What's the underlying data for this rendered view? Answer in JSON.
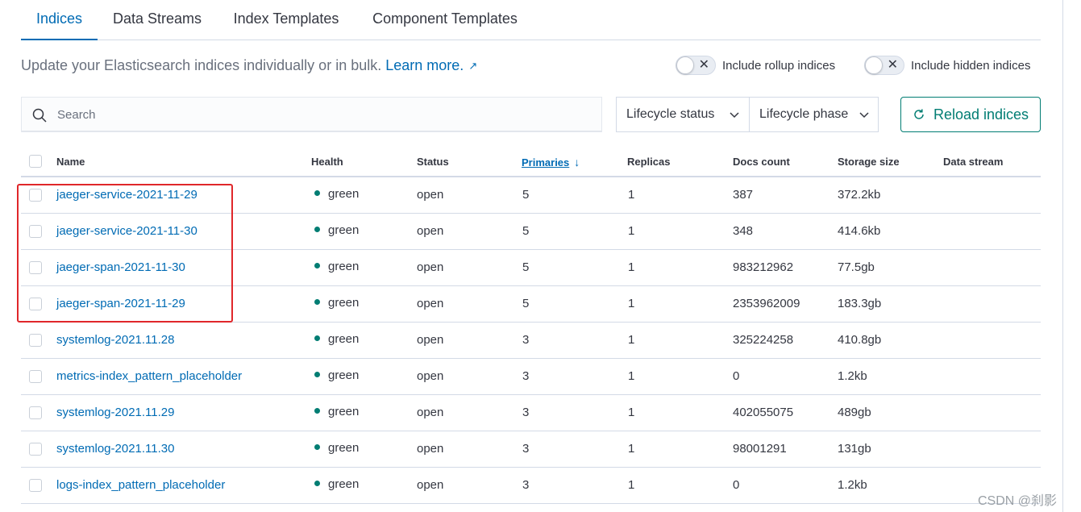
{
  "tabs": [
    {
      "label": "Indices",
      "active": true
    },
    {
      "label": "Data Streams",
      "active": false
    },
    {
      "label": "Index Templates",
      "active": false
    },
    {
      "label": "Component Templates",
      "active": false
    }
  ],
  "description": {
    "text": "Update your Elasticsearch indices individually or in bulk.",
    "link": "Learn more."
  },
  "toggles": {
    "rollup": "Include rollup indices",
    "hidden": "Include hidden indices"
  },
  "search": {
    "placeholder": "Search"
  },
  "filters": {
    "lifecycle_status": "Lifecycle status",
    "lifecycle_phase": "Lifecycle phase"
  },
  "reload_label": "Reload indices",
  "table": {
    "headers": {
      "name": "Name",
      "health": "Health",
      "status": "Status",
      "primaries": "Primaries",
      "replicas": "Replicas",
      "docs": "Docs count",
      "storage": "Storage size",
      "datastream": "Data stream"
    },
    "rows": [
      {
        "name": "jaeger-service-2021-11-29",
        "health": "green",
        "status": "open",
        "primaries": "5",
        "replicas": "1",
        "docs": "387",
        "storage": "372.2kb",
        "datastream": ""
      },
      {
        "name": "jaeger-service-2021-11-30",
        "health": "green",
        "status": "open",
        "primaries": "5",
        "replicas": "1",
        "docs": "348",
        "storage": "414.6kb",
        "datastream": ""
      },
      {
        "name": "jaeger-span-2021-11-30",
        "health": "green",
        "status": "open",
        "primaries": "5",
        "replicas": "1",
        "docs": "983212962",
        "storage": "77.5gb",
        "datastream": ""
      },
      {
        "name": "jaeger-span-2021-11-29",
        "health": "green",
        "status": "open",
        "primaries": "5",
        "replicas": "1",
        "docs": "2353962009",
        "storage": "183.3gb",
        "datastream": ""
      },
      {
        "name": "systemlog-2021.11.28",
        "health": "green",
        "status": "open",
        "primaries": "3",
        "replicas": "1",
        "docs": "325224258",
        "storage": "410.8gb",
        "datastream": ""
      },
      {
        "name": "metrics-index_pattern_placeholder",
        "health": "green",
        "status": "open",
        "primaries": "3",
        "replicas": "1",
        "docs": "0",
        "storage": "1.2kb",
        "datastream": ""
      },
      {
        "name": "systemlog-2021.11.29",
        "health": "green",
        "status": "open",
        "primaries": "3",
        "replicas": "1",
        "docs": "402055075",
        "storage": "489gb",
        "datastream": ""
      },
      {
        "name": "systemlog-2021.11.30",
        "health": "green",
        "status": "open",
        "primaries": "3",
        "replicas": "1",
        "docs": "98001291",
        "storage": "131gb",
        "datastream": ""
      },
      {
        "name": "logs-index_pattern_placeholder",
        "health": "green",
        "status": "open",
        "primaries": "3",
        "replicas": "1",
        "docs": "0",
        "storage": "1.2kb",
        "datastream": ""
      }
    ]
  },
  "colors": {
    "link": "#006bb4",
    "health_green": "#017d73",
    "reload": "#017d73",
    "highlight": "#e0272a"
  },
  "watermark": "CSDN @刹影"
}
